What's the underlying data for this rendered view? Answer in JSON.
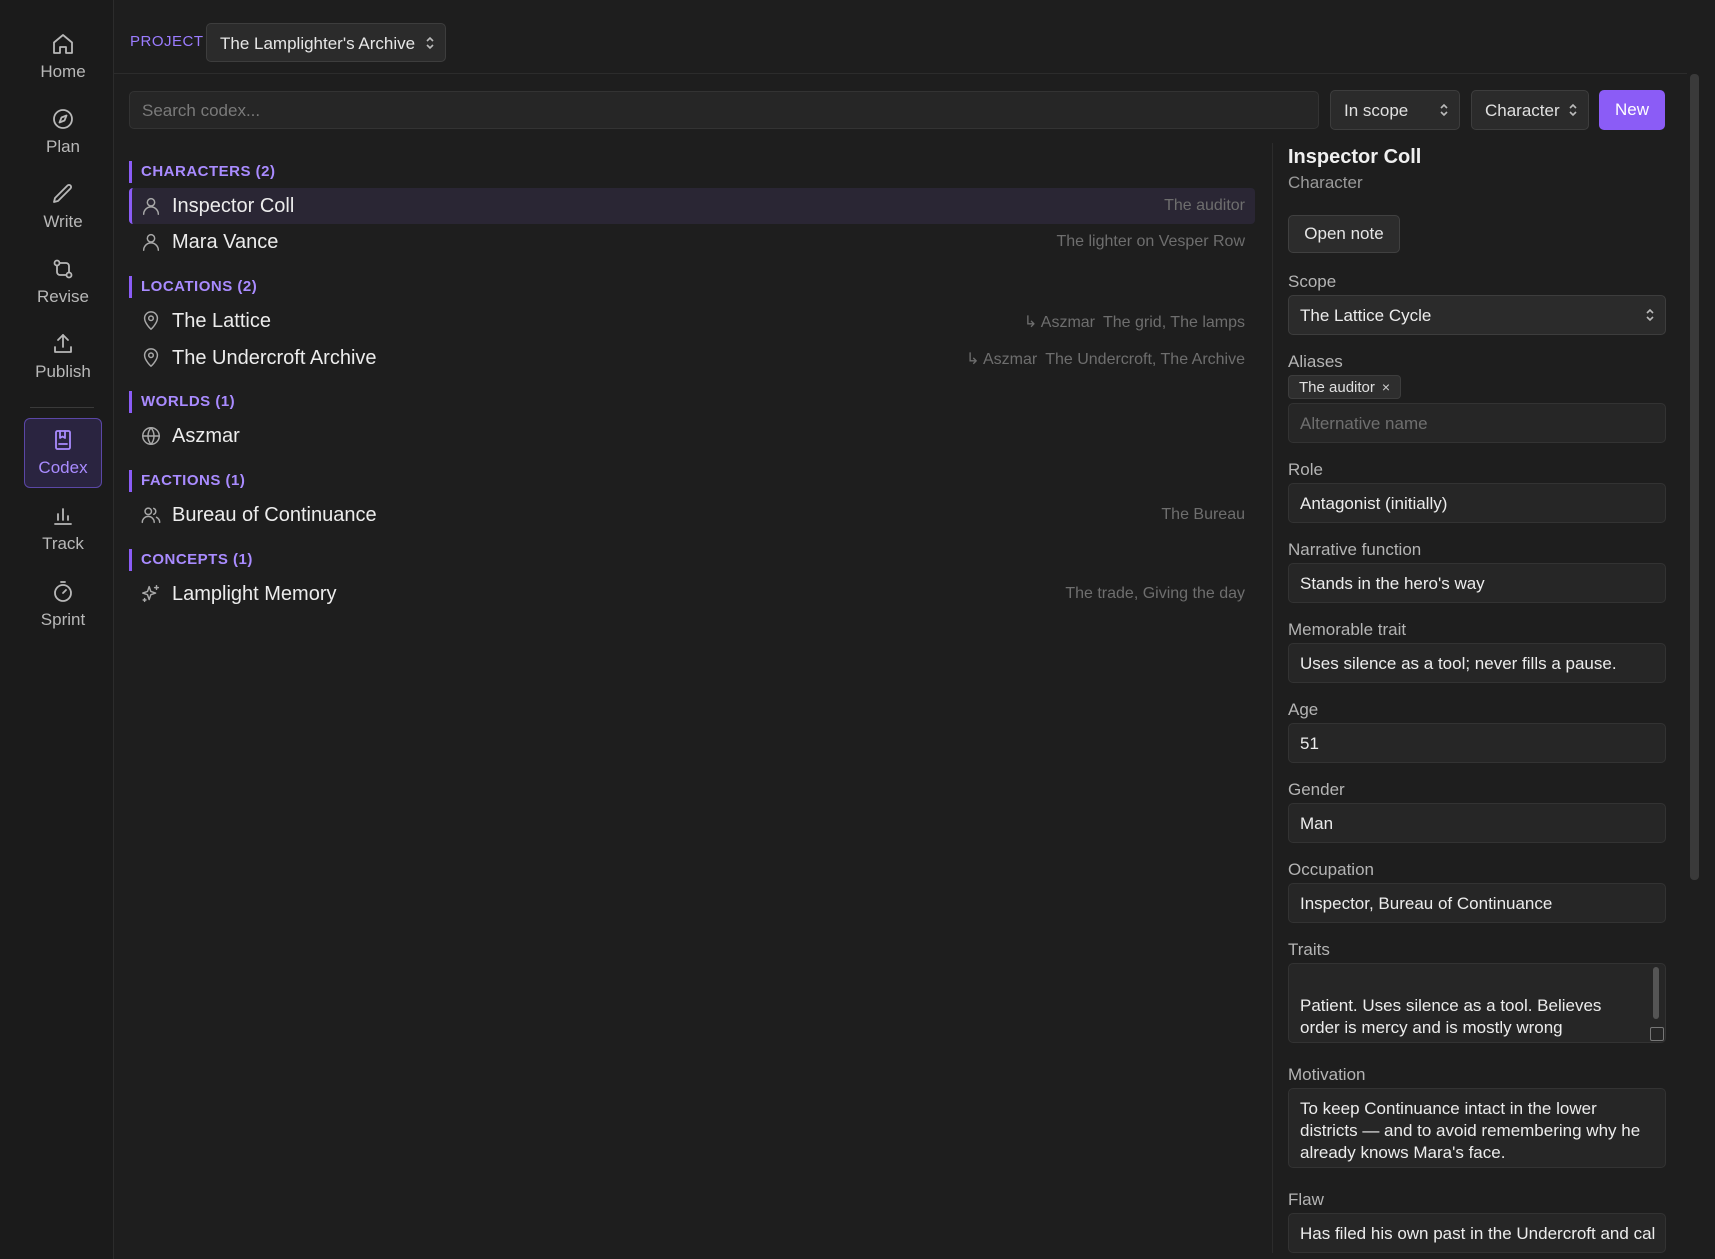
{
  "nav": {
    "items": [
      {
        "label": "Home",
        "icon": "home-icon"
      },
      {
        "label": "Plan",
        "icon": "compass-icon"
      },
      {
        "label": "Write",
        "icon": "pencil-icon"
      },
      {
        "label": "Revise",
        "icon": "git-compare-icon"
      },
      {
        "label": "Publish",
        "icon": "upload-icon"
      },
      {
        "label": "Codex",
        "icon": "book-icon",
        "active": true
      },
      {
        "label": "Track",
        "icon": "bar-chart-icon"
      },
      {
        "label": "Sprint",
        "icon": "timer-icon"
      }
    ]
  },
  "project": {
    "label": "PROJECT",
    "selected": "The Lamplighter's Archive"
  },
  "toolbar": {
    "search_placeholder": "Search codex...",
    "scope_filter": "In scope",
    "type_filter": "Character",
    "new_label": "New"
  },
  "groups": [
    {
      "heading": "CHARACTERS (2)",
      "entries": [
        {
          "name": "Inspector Coll",
          "icon": "user-icon",
          "aliases": "The auditor",
          "selected": true
        },
        {
          "name": "Mara Vance",
          "icon": "user-icon",
          "aliases": "The lighter on Vesper Row"
        }
      ]
    },
    {
      "heading": "LOCATIONS (2)",
      "entries": [
        {
          "name": "The Lattice",
          "icon": "map-pin-icon",
          "world": "↳ Aszmar",
          "aliases": "The grid, The lamps"
        },
        {
          "name": "The Undercroft Archive",
          "icon": "map-pin-icon",
          "world": "↳ Aszmar",
          "aliases": "The Undercroft, The Archive"
        }
      ]
    },
    {
      "heading": "WORLDS (1)",
      "entries": [
        {
          "name": "Aszmar",
          "icon": "globe-icon"
        }
      ]
    },
    {
      "heading": "FACTIONS (1)",
      "entries": [
        {
          "name": "Bureau of Continuance",
          "icon": "users-icon",
          "aliases": "The Bureau"
        }
      ]
    },
    {
      "heading": "CONCEPTS (1)",
      "entries": [
        {
          "name": "Lamplight Memory",
          "icon": "sparkles-icon",
          "aliases": "The trade, Giving the day"
        }
      ]
    }
  ],
  "detail": {
    "title": "Inspector Coll",
    "type": "Character",
    "open_note_label": "Open note",
    "scope": {
      "label": "Scope",
      "value": "The Lattice Cycle"
    },
    "aliases": {
      "label": "Aliases",
      "chip": "The auditor",
      "chip_remove": "×",
      "placeholder": "Alternative name"
    },
    "role": {
      "label": "Role",
      "value": "Antagonist (initially)"
    },
    "narrative_function": {
      "label": "Narrative function",
      "value": "Stands in the hero's way"
    },
    "memorable_trait": {
      "label": "Memorable trait",
      "value": "Uses silence as a tool; never fills a pause."
    },
    "age": {
      "label": "Age",
      "value": "51"
    },
    "gender": {
      "label": "Gender",
      "value": "Man"
    },
    "occupation": {
      "label": "Occupation",
      "value": "Inspector, Bureau of Continuance"
    },
    "traits": {
      "label": "Traits",
      "value": "Patient. Uses silence as a tool. Believes order is mercy and is mostly wrong\nabout that in the ways that matter."
    },
    "motivation": {
      "label": "Motivation",
      "value": "To keep Continuance intact in the lower districts — and to avoid remembering why he already knows Mara's face."
    },
    "flaw": {
      "label": "Flaw",
      "value": "Has filed his own past in the Undercroft and cal"
    }
  },
  "colors": {
    "accent": "#8b5cf6",
    "accent_text": "#a98bff",
    "background": "#1e1e1e"
  }
}
